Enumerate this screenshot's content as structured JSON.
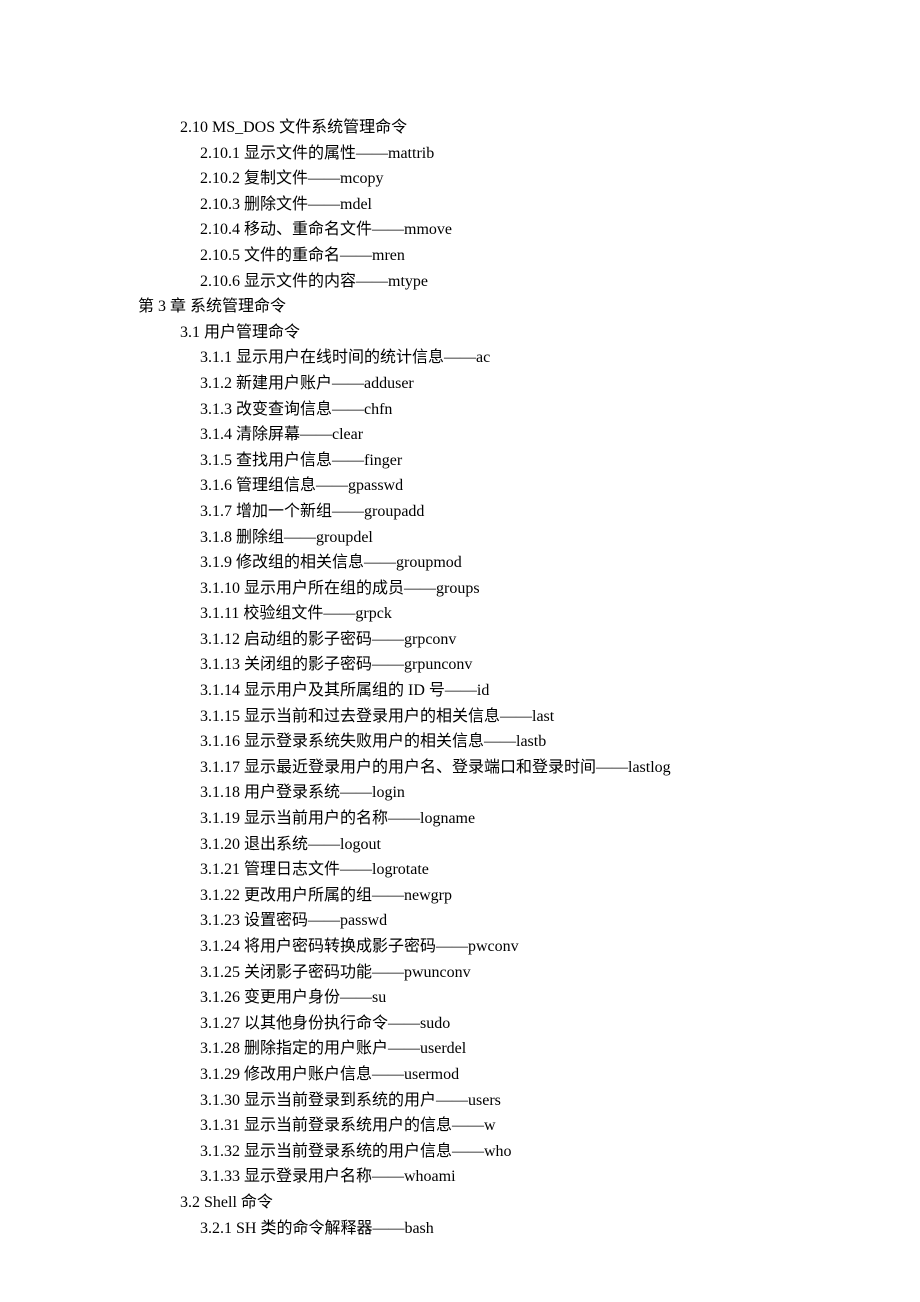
{
  "toc": [
    {
      "level": 2,
      "text": "2.10 MS_DOS 文件系统管理命令"
    },
    {
      "level": 3,
      "text": "2.10.1 显示文件的属性——mattrib"
    },
    {
      "level": 3,
      "text": "2.10.2 复制文件——mcopy"
    },
    {
      "level": 3,
      "text": "2.10.3 删除文件——mdel"
    },
    {
      "level": 3,
      "text": "2.10.4 移动、重命名文件——mmove"
    },
    {
      "level": 3,
      "text": "2.10.5 文件的重命名——mren"
    },
    {
      "level": 3,
      "text": "2.10.6 显示文件的内容——mtype"
    },
    {
      "level": 1,
      "text": "第 3 章 系统管理命令"
    },
    {
      "level": 2,
      "text": "3.1 用户管理命令"
    },
    {
      "level": 3,
      "text": "3.1.1 显示用户在线时间的统计信息——ac"
    },
    {
      "level": 3,
      "text": "3.1.2 新建用户账户——adduser"
    },
    {
      "level": 3,
      "text": "3.1.3 改变查询信息——chfn"
    },
    {
      "level": 3,
      "text": "3.1.4 清除屏幕——clear"
    },
    {
      "level": 3,
      "text": "3.1.5 查找用户信息——finger"
    },
    {
      "level": 3,
      "text": "3.1.6 管理组信息——gpasswd"
    },
    {
      "level": 3,
      "text": "3.1.7 增加一个新组——groupadd"
    },
    {
      "level": 3,
      "text": "3.1.8 删除组——groupdel"
    },
    {
      "level": 3,
      "text": "3.1.9 修改组的相关信息——groupmod"
    },
    {
      "level": 3,
      "text": "3.1.10 显示用户所在组的成员——groups"
    },
    {
      "level": 3,
      "text": "3.1.11 校验组文件——grpck"
    },
    {
      "level": 3,
      "text": "3.1.12 启动组的影子密码——grpconv"
    },
    {
      "level": 3,
      "text": "3.1.13 关闭组的影子密码——grpunconv"
    },
    {
      "level": 3,
      "text": "3.1.14 显示用户及其所属组的 ID 号——id"
    },
    {
      "level": 3,
      "text": "3.1.15 显示当前和过去登录用户的相关信息——last"
    },
    {
      "level": 3,
      "text": "3.1.16 显示登录系统失败用户的相关信息——lastb"
    },
    {
      "level": 3,
      "text": "3.1.17 显示最近登录用户的用户名、登录端口和登录时间——lastlog"
    },
    {
      "level": 3,
      "text": "3.1.18 用户登录系统——login"
    },
    {
      "level": 3,
      "text": "3.1.19 显示当前用户的名称——logname"
    },
    {
      "level": 3,
      "text": "3.1.20 退出系统——logout"
    },
    {
      "level": 3,
      "text": "3.1.21 管理日志文件——logrotate"
    },
    {
      "level": 3,
      "text": "3.1.22 更改用户所属的组——newgrp"
    },
    {
      "level": 3,
      "text": "3.1.23 设置密码——passwd"
    },
    {
      "level": 3,
      "text": "3.1.24 将用户密码转换成影子密码——pwconv"
    },
    {
      "level": 3,
      "text": "3.1.25 关闭影子密码功能——pwunconv"
    },
    {
      "level": 3,
      "text": "3.1.26 变更用户身份——su"
    },
    {
      "level": 3,
      "text": "3.1.27 以其他身份执行命令——sudo"
    },
    {
      "level": 3,
      "text": "3.1.28 删除指定的用户账户——userdel"
    },
    {
      "level": 3,
      "text": "3.1.29 修改用户账户信息——usermod"
    },
    {
      "level": 3,
      "text": "3.1.30 显示当前登录到系统的用户——users"
    },
    {
      "level": 3,
      "text": "3.1.31 显示当前登录系统用户的信息——w"
    },
    {
      "level": 3,
      "text": "3.1.32 显示当前登录系统的用户信息——who"
    },
    {
      "level": 3,
      "text": "3.1.33 显示登录用户名称——whoami"
    },
    {
      "level": 2,
      "text": "3.2 Shell 命令"
    },
    {
      "level": 3,
      "text": "3.2.1 SH 类的命令解释器——bash"
    }
  ]
}
